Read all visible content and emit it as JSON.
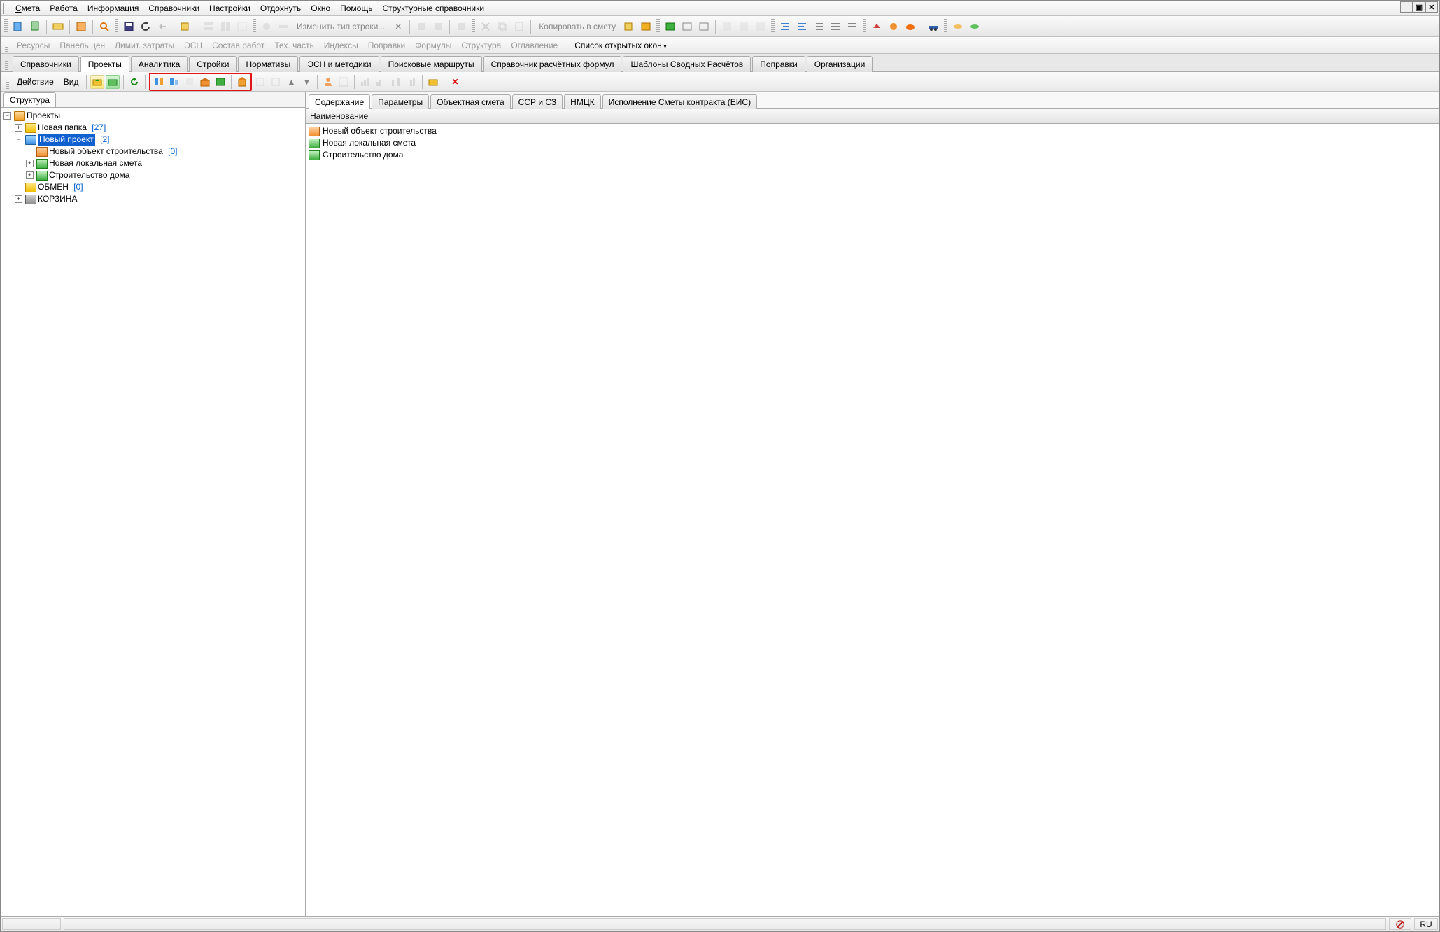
{
  "menubar": [
    "Смета",
    "Работа",
    "Информация",
    "Справочники",
    "Настройки",
    "Отдохнуть",
    "Окно",
    "Помощь",
    "Структурные справочники"
  ],
  "toolbar1": {
    "change_type_label": "Изменить тип строки...",
    "copy_to_label": "Копировать в смету"
  },
  "linkbar": {
    "items": [
      "Ресурсы",
      "Панель цен",
      "Лимит. затраты",
      "ЭСН",
      "Состав работ",
      "Тех. часть",
      "Индексы",
      "Поправки",
      "Формулы",
      "Структура",
      "Оглавление"
    ],
    "active": "Список открытых окон"
  },
  "tabs_main": [
    "Справочники",
    "Проекты",
    "Аналитика",
    "Стройки",
    "Нормативы",
    "ЭСН и методики",
    "Поисковые маршруты",
    "Справочник расчётных формул",
    "Шаблоны Сводных Расчётов",
    "Поправки",
    "Организации"
  ],
  "tabs_main_active": "Проекты",
  "actionbar": {
    "action": "Действие",
    "view": "Вид"
  },
  "left_tab": "Структура",
  "tree": {
    "root": "Проекты",
    "folder1": {
      "name": "Новая папка",
      "count": "[27]"
    },
    "proj": {
      "name": "Новый проект",
      "count": "[2]"
    },
    "obj": {
      "name": "Новый объект строительства",
      "count": "[0]"
    },
    "smeta": "Новая локальная смета",
    "house": "Строительство дома",
    "exchange": {
      "name": "ОБМЕН",
      "count": "[0]"
    },
    "bin": "КОРЗИНА"
  },
  "detail_tabs": [
    "Содержание",
    "Параметры",
    "Объектная смета",
    "ССР и СЗ",
    "НМЦК",
    "Исполнение Сметы контракта (ЕИС)"
  ],
  "detail_tabs_active": "Содержание",
  "grid_header": "Наименование",
  "detail_rows": [
    "Новый объект строительства",
    "Новая локальная смета",
    "Строительство дома"
  ],
  "status_lang": "RU"
}
